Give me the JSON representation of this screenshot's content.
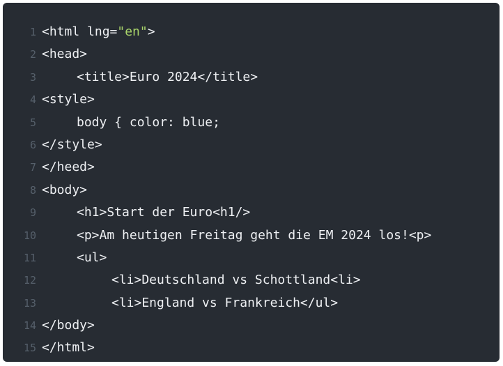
{
  "lines": [
    {
      "n": "1",
      "parts": [
        {
          "t": "<html lng=",
          "c": "tag"
        },
        {
          "t": "\"en\"",
          "c": "str"
        },
        {
          "t": ">",
          "c": "tag"
        }
      ],
      "indent": 0
    },
    {
      "n": "2",
      "parts": [
        {
          "t": "<head>",
          "c": "tag"
        }
      ],
      "indent": 0
    },
    {
      "n": "3",
      "parts": [
        {
          "t": "<title>Euro 2024</title>",
          "c": "tag"
        }
      ],
      "indent": 1
    },
    {
      "n": "4",
      "parts": [
        {
          "t": "<style>",
          "c": "tag"
        }
      ],
      "indent": 0
    },
    {
      "n": "5",
      "parts": [
        {
          "t": "body { color: blue;",
          "c": "tag"
        }
      ],
      "indent": 1
    },
    {
      "n": "6",
      "parts": [
        {
          "t": "</style>",
          "c": "tag"
        }
      ],
      "indent": 0
    },
    {
      "n": "7",
      "parts": [
        {
          "t": "</heed>",
          "c": "tag"
        }
      ],
      "indent": 0
    },
    {
      "n": "8",
      "parts": [
        {
          "t": "<body>",
          "c": "tag"
        }
      ],
      "indent": 0
    },
    {
      "n": "9",
      "parts": [
        {
          "t": "<h1>Start der Euro<h1/>",
          "c": "tag"
        }
      ],
      "indent": 1
    },
    {
      "n": "10",
      "parts": [
        {
          "t": "<p>Am heutigen Freitag geht die EM 2024 los!<p>",
          "c": "tag"
        }
      ],
      "indent": 1
    },
    {
      "n": "11",
      "parts": [
        {
          "t": "<ul>",
          "c": "tag"
        }
      ],
      "indent": 1
    },
    {
      "n": "12",
      "parts": [
        {
          "t": "<li>Deutschland vs Schottland<li>",
          "c": "tag"
        }
      ],
      "indent": 2
    },
    {
      "n": "13",
      "parts": [
        {
          "t": "<li>England vs Frankreich</ul>",
          "c": "tag"
        }
      ],
      "indent": 2
    },
    {
      "n": "14",
      "parts": [
        {
          "t": "</body>",
          "c": "tag"
        }
      ],
      "indent": 0
    },
    {
      "n": "15",
      "parts": [
        {
          "t": "</html>",
          "c": "tag"
        }
      ],
      "indent": 0
    }
  ],
  "colors": {
    "background": "#272c33",
    "text": "#eef0f3",
    "string": "#a9d46a",
    "line_number": "#56606b"
  }
}
